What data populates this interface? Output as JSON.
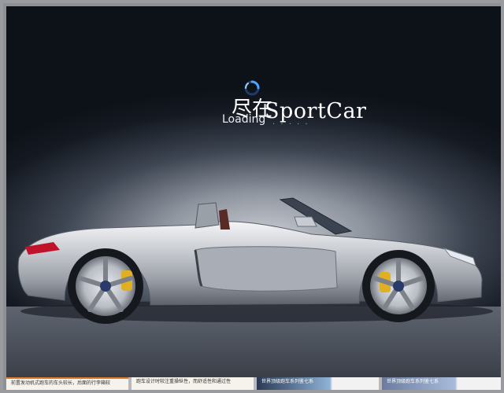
{
  "splash": {
    "title_zh": "尽在",
    "title_en": "SportCar",
    "loading_label": "Loading",
    "loading_dots": ". . . . ."
  },
  "thumbnails": [
    {
      "text": "前置发动机式跑车的车头较长，后面的行李箱较"
    },
    {
      "text": "跑车设计时较注重操纵性，而舒适性和通过性"
    },
    {
      "text": "世界顶级跑车系列鉴七系"
    },
    {
      "text": "世界顶级跑车系列鉴七系"
    }
  ],
  "colors": {
    "accent_spinner": "#4aa3ff",
    "brake_caliper": "#e0b020",
    "tail_light": "#c0122a"
  },
  "icons": [
    "loading-spinner-icon",
    "car-image"
  ]
}
